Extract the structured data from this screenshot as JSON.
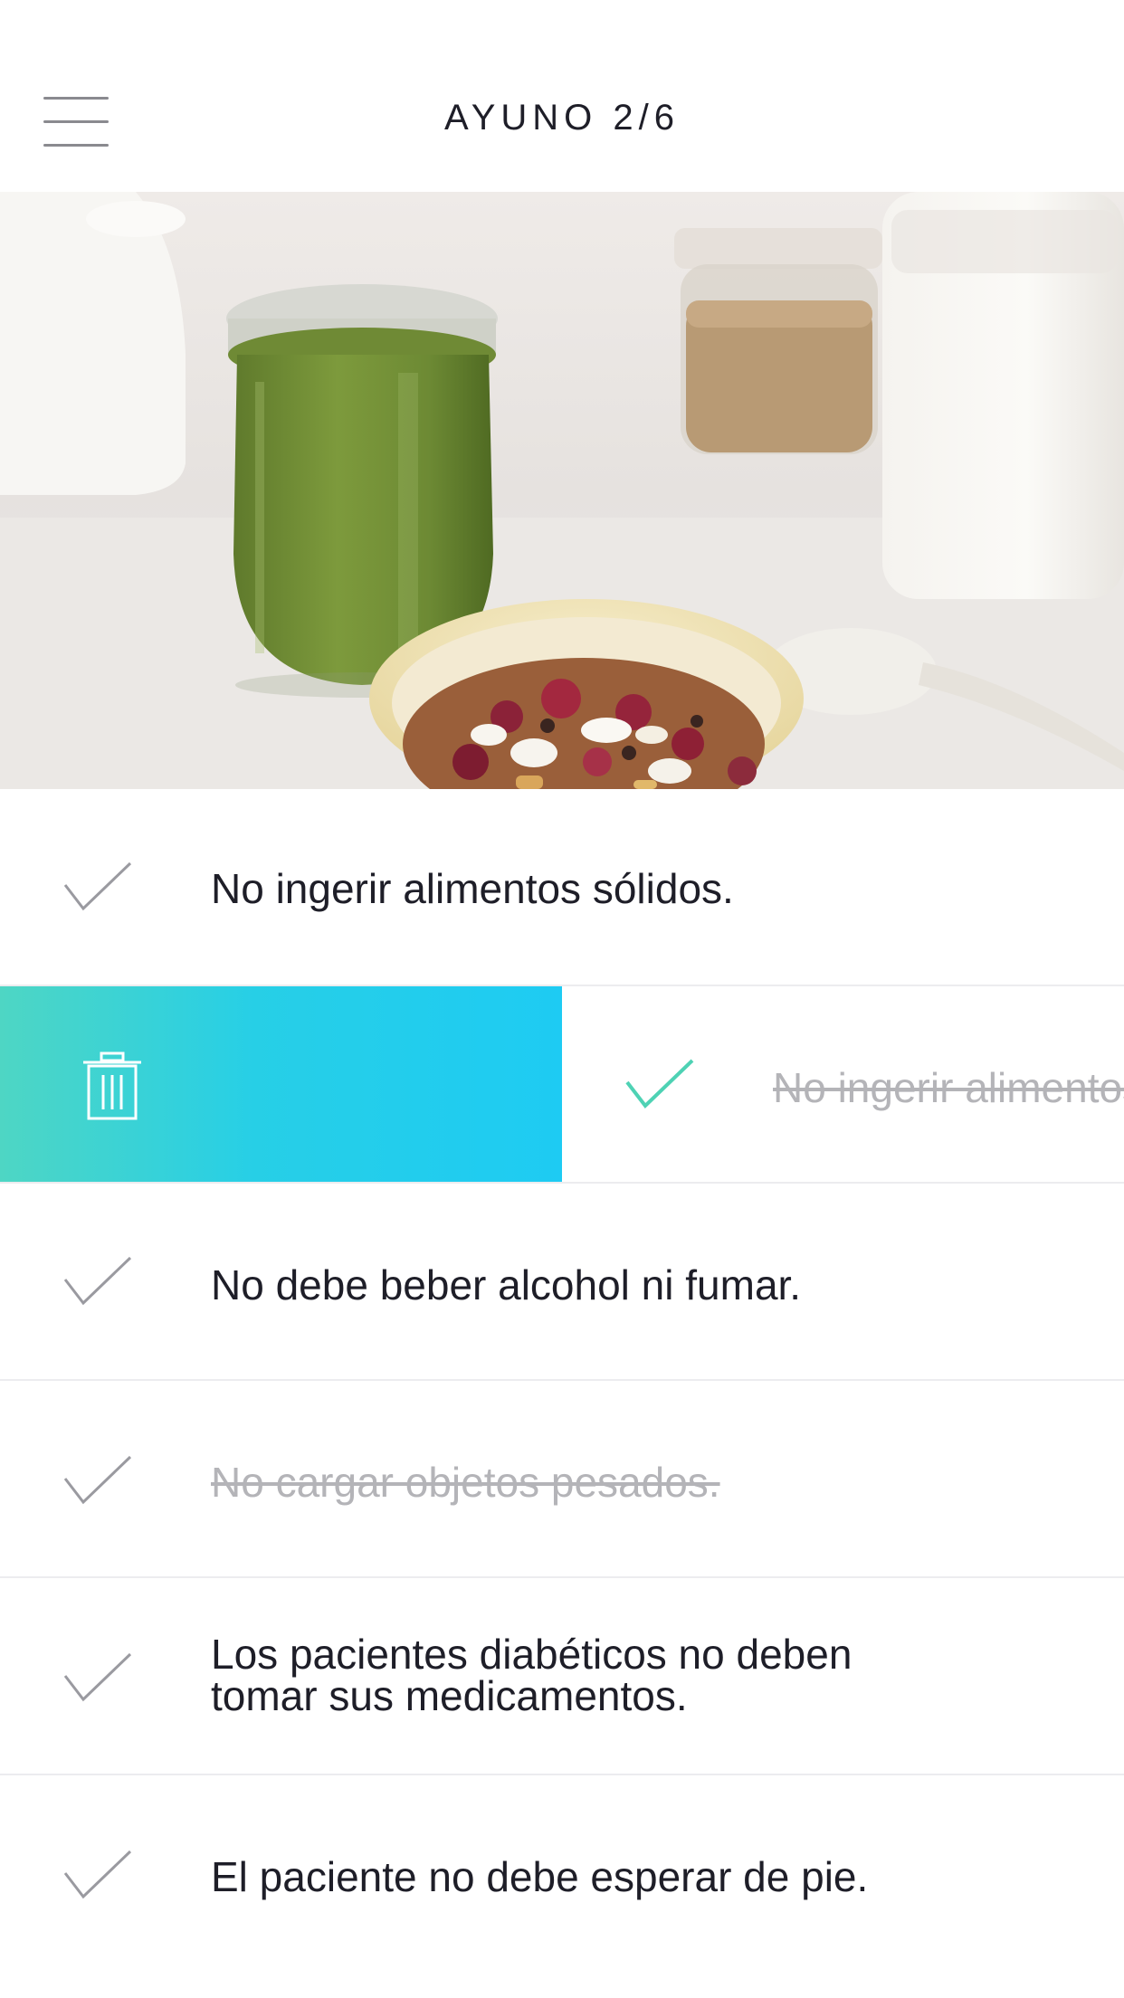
{
  "header": {
    "title": "AYUNO 2/6",
    "menu_icon": "hamburger-menu-icon"
  },
  "hero": {
    "image": "food-photo"
  },
  "colors": {
    "accent_gradient_start": "#4ed6c4",
    "accent_gradient_end": "#1ecbf3",
    "check_active": "#4ed2b4",
    "check_inactive": "#9a9aa0",
    "done_text": "#b4b4b8"
  },
  "list": {
    "items": [
      {
        "text": "No ingerir alimentos sólidos.",
        "done": false
      },
      {
        "text": "No ingerir alimentos sólidos.",
        "done": true,
        "swiped": true,
        "action_icon": "trash-icon"
      },
      {
        "text": "No debe beber alcohol ni fumar.",
        "done": false
      },
      {
        "text": "No cargar objetos pesados.",
        "done": true
      },
      {
        "text_line1": "Los pacientes diabéticos no deben",
        "text_line2": "tomar sus medicamentos.",
        "done": false
      },
      {
        "text": "El paciente no debe esperar de pie.",
        "done": false
      }
    ]
  }
}
